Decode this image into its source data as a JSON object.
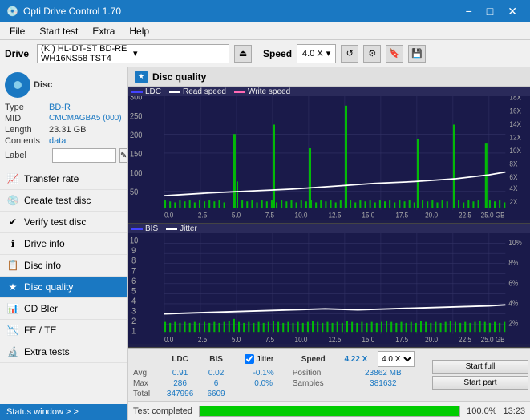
{
  "titlebar": {
    "title": "Opti Drive Control 1.70",
    "minimize": "−",
    "maximize": "□",
    "close": "✕"
  },
  "menubar": {
    "items": [
      "File",
      "Start test",
      "Extra",
      "Help"
    ]
  },
  "drivebar": {
    "label": "Drive",
    "drive_value": "(K:)  HL-DT-ST BD-RE  WH16NS58 TST4",
    "speed_label": "Speed",
    "speed_value": "4.0 X"
  },
  "sidebar": {
    "disc": {
      "type_label": "Type",
      "type_val": "BD-R",
      "mid_label": "MID",
      "mid_val": "CMCMAGBA5 (000)",
      "length_label": "Length",
      "length_val": "23.31 GB",
      "contents_label": "Contents",
      "contents_val": "data",
      "label_label": "Label"
    },
    "nav": [
      {
        "id": "transfer-rate",
        "label": "Transfer rate",
        "icon": "📈"
      },
      {
        "id": "create-test-disc",
        "label": "Create test disc",
        "icon": "💿"
      },
      {
        "id": "verify-test-disc",
        "label": "Verify test disc",
        "icon": "✔"
      },
      {
        "id": "drive-info",
        "label": "Drive info",
        "icon": "ℹ"
      },
      {
        "id": "disc-info",
        "label": "Disc info",
        "icon": "📋"
      },
      {
        "id": "disc-quality",
        "label": "Disc quality",
        "icon": "★",
        "active": true
      },
      {
        "id": "cd-bler",
        "label": "CD Bler",
        "icon": "📊"
      },
      {
        "id": "fe-te",
        "label": "FE / TE",
        "icon": "📉"
      },
      {
        "id": "extra-tests",
        "label": "Extra tests",
        "icon": "🔬"
      }
    ],
    "status_window": "Status window > >"
  },
  "disc_quality": {
    "title": "Disc quality",
    "chart1": {
      "legend": [
        {
          "label": "LDC",
          "color": "#0000ff"
        },
        {
          "label": "Read speed",
          "color": "#ffffff"
        },
        {
          "label": "Write speed",
          "color": "#ff69b4"
        }
      ],
      "y_max": 300,
      "y_right_labels": [
        "18X",
        "16X",
        "14X",
        "12X",
        "10X",
        "8X",
        "6X",
        "4X",
        "2X"
      ],
      "x_labels": [
        "0.0",
        "2.5",
        "5.0",
        "7.5",
        "10.0",
        "12.5",
        "15.0",
        "17.5",
        "20.0",
        "22.5",
        "25.0 GB"
      ]
    },
    "chart2": {
      "legend": [
        {
          "label": "BIS",
          "color": "#0000ff"
        },
        {
          "label": "Jitter",
          "color": "#ffffff"
        }
      ],
      "y_labels": [
        "10",
        "9",
        "8",
        "7",
        "6",
        "5",
        "4",
        "3",
        "2",
        "1"
      ],
      "y_right_labels": [
        "10%",
        "8%",
        "6%",
        "4%",
        "2%"
      ],
      "x_labels": [
        "0.0",
        "2.5",
        "5.0",
        "7.5",
        "10.0",
        "12.5",
        "15.0",
        "17.5",
        "20.0",
        "22.5",
        "25.0 GB"
      ]
    },
    "stats": {
      "headers": [
        "LDC",
        "BIS",
        "",
        "Jitter",
        "Speed",
        "",
        "",
        ""
      ],
      "avg_label": "Avg",
      "avg_ldc": "0.91",
      "avg_bis": "0.02",
      "avg_jitter": "-0.1%",
      "max_label": "Max",
      "max_ldc": "286",
      "max_bis": "6",
      "max_jitter": "0.0%",
      "total_label": "Total",
      "total_ldc": "347996",
      "total_bis": "6609",
      "jitter_checked": true,
      "jitter_label": "Jitter",
      "speed_label": "Speed",
      "speed_val": "4.22 X",
      "speed_select": "4.0 X",
      "position_label": "Position",
      "position_val": "23862 MB",
      "samples_label": "Samples",
      "samples_val": "381632",
      "start_full": "Start full",
      "start_part": "Start part"
    }
  },
  "progressbar": {
    "fill_pct": 100,
    "pct_text": "100.0%",
    "status": "Test completed",
    "time": "13:23"
  }
}
